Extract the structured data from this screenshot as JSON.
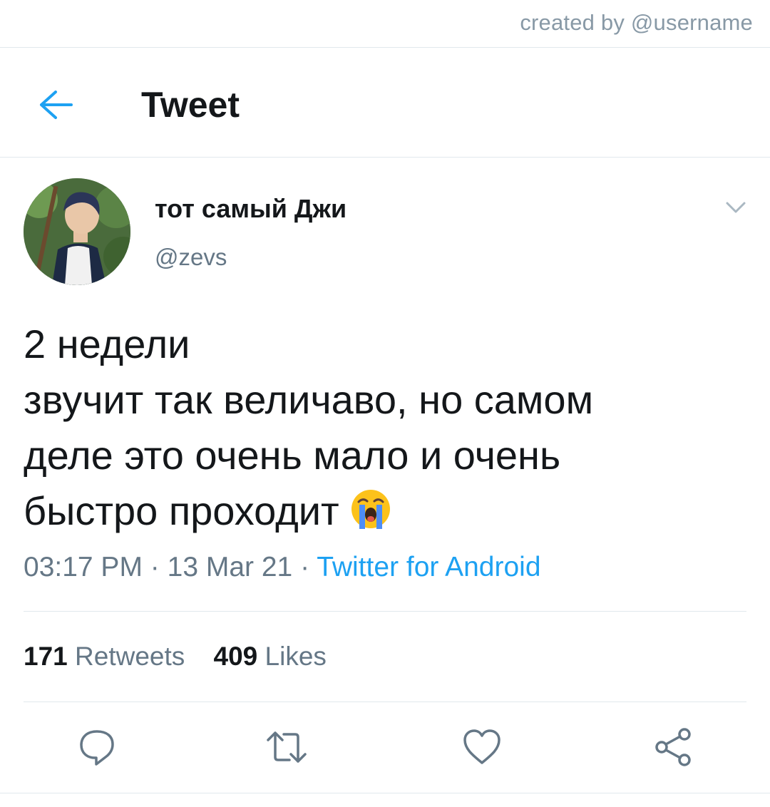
{
  "watermark": "created by @username",
  "header": {
    "back_icon": "arrow-left-icon",
    "title": "Tweet"
  },
  "tweet": {
    "author": {
      "display_name": "тот самый Джи",
      "handle": "@zevs"
    },
    "text_lines": [
      "2 недели",
      "звучит так величаво, но самом",
      "деле это очень мало и очень",
      "быстро проходит"
    ],
    "emoji": "loudly-crying-face-emoji",
    "time": "03:17 PM",
    "date": "13 Mar 21",
    "separator": "·",
    "source": "Twitter for Android",
    "stats": {
      "retweets_count": "171",
      "retweets_label": "Retweets",
      "likes_count": "409",
      "likes_label": "Likes"
    }
  },
  "actions": {
    "reply": "reply-icon",
    "retweet": "retweet-icon",
    "like": "heart-icon",
    "share": "share-icon"
  },
  "colors": {
    "accent": "#1da1f2",
    "text_primary": "#14171a",
    "text_secondary": "#657786",
    "divider": "#e1e8ed"
  }
}
